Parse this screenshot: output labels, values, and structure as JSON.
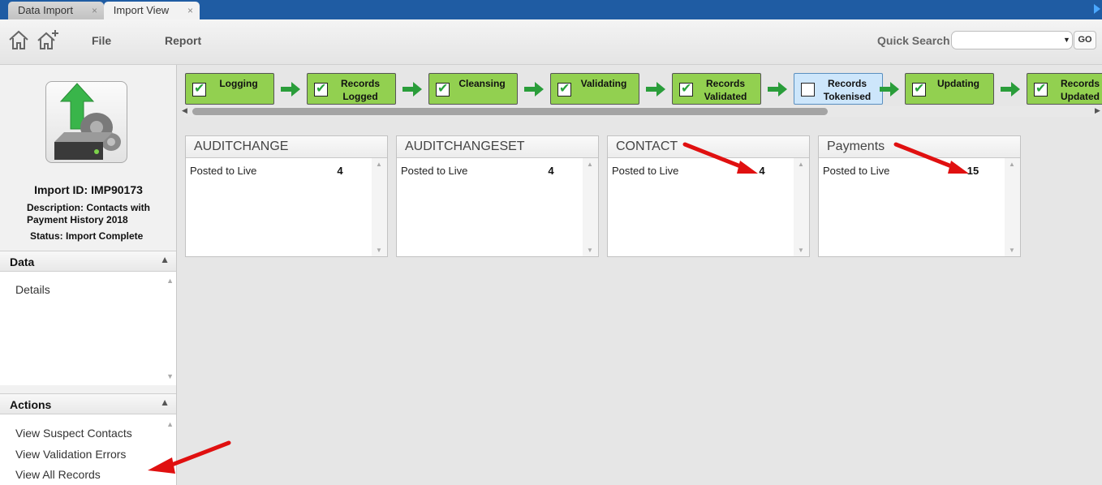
{
  "tabs": [
    {
      "label": "Data Import",
      "close": "×"
    },
    {
      "label": "Import View",
      "close": "×"
    }
  ],
  "toolbar": {
    "file_label": "File",
    "report_label": "Report",
    "quick_search_label": "Quick Search",
    "quick_search_value": "",
    "go_label": "GO",
    "icons": [
      "home-icon",
      "home-add-icon",
      "chevron-down-icon"
    ]
  },
  "import": {
    "id": "Import ID: IMP90173",
    "description": "Description: Contacts with Payment History 2018",
    "status": "Status: Import Complete"
  },
  "sidebar": {
    "data_header": "Data",
    "data_items": [
      "Details"
    ],
    "actions_header": "Actions",
    "action_items": [
      "View Suspect Contacts",
      "View Validation Errors",
      "View All Records"
    ]
  },
  "steps": [
    {
      "label": "Logging",
      "done": true
    },
    {
      "label": "Records Logged",
      "done": true
    },
    {
      "label": "Cleansing",
      "done": true
    },
    {
      "label": "Validating",
      "done": true
    },
    {
      "label": "Records Validated",
      "done": true
    },
    {
      "label": "Records Tokenised",
      "done": false
    },
    {
      "label": "Updating",
      "done": true
    },
    {
      "label": "Records Updated",
      "done": true
    }
  ],
  "tables": [
    {
      "title": "AUDITCHANGE",
      "row_label": "Posted to Live",
      "row_value": "4"
    },
    {
      "title": "AUDITCHANGESET",
      "row_label": "Posted to Live",
      "row_value": "4"
    },
    {
      "title": "CONTACT",
      "row_label": "Posted to Live",
      "row_value": "4"
    },
    {
      "title": "Payments",
      "row_label": "Posted to Live",
      "row_value": "15"
    }
  ],
  "colors": {
    "tabbar": "#1f5ca3",
    "step_done": "#92d050",
    "step_current": "#cde6fb",
    "arrow_green": "#2a9d3a",
    "annotation_red": "#e01010"
  }
}
